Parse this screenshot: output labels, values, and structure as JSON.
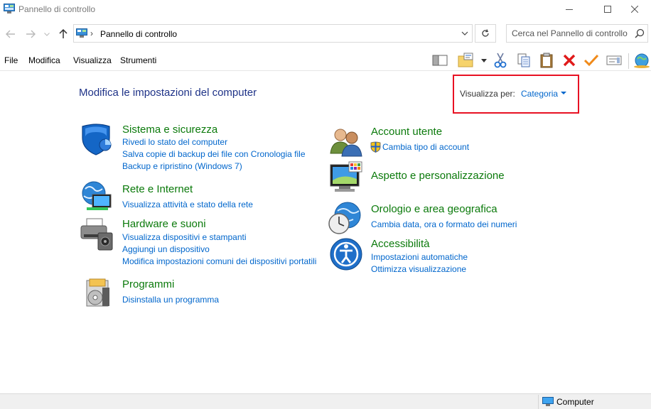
{
  "window": {
    "title": "Pannello di controllo"
  },
  "address": {
    "path": "Pannello di controllo",
    "search_placeholder": "Cerca nel Pannello di controllo"
  },
  "menu": {
    "file": "File",
    "edit": "Modifica",
    "view": "Visualizza",
    "tools": "Strumenti"
  },
  "content": {
    "title": "Modifica le impostazioni del computer",
    "view_by_label": "Visualizza per:",
    "view_by_value": "Categoria"
  },
  "categories": {
    "system": {
      "title": "Sistema e sicurezza",
      "links": [
        "Rivedi lo stato del computer",
        "Salva copie di backup dei file con Cronologia file",
        "Backup e ripristino (Windows 7)"
      ]
    },
    "network": {
      "title": "Rete e Internet",
      "links": [
        "Visualizza attività e stato della rete"
      ]
    },
    "hardware": {
      "title": "Hardware e suoni",
      "links": [
        "Visualizza dispositivi e stampanti",
        "Aggiungi un dispositivo",
        "Modifica impostazioni comuni dei dispositivi portatili"
      ]
    },
    "programs": {
      "title": "Programmi",
      "links": [
        "Disinstalla un programma"
      ]
    },
    "accounts": {
      "title": "Account utente",
      "links": [
        "Cambia tipo di account"
      ]
    },
    "appearance": {
      "title": "Aspetto e personalizzazione",
      "links": []
    },
    "clock": {
      "title": "Orologio e area geografica",
      "links": [
        "Cambia data, ora o formato dei numeri"
      ]
    },
    "access": {
      "title": "Accessibilità",
      "links": [
        "Impostazioni automatiche",
        "Ottimizza visualizzazione"
      ]
    }
  },
  "status": {
    "text": "Computer"
  },
  "colors": {
    "link": "#0066cc",
    "category_title": "#0b7a0b",
    "page_title": "#1e3287",
    "highlight_box": "#e81123"
  }
}
